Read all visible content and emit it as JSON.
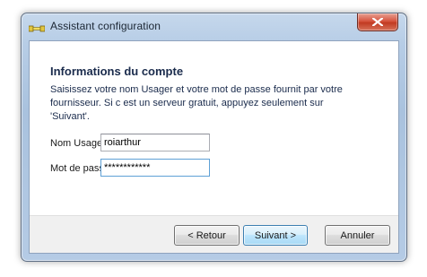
{
  "window": {
    "title": "Assistant configuration",
    "icon": "cable-plug-icon",
    "close_symbol": "close-icon"
  },
  "page": {
    "heading": "Informations du compte",
    "description": "Saisissez votre nom Usager et votre mot de passe fournit par votre fournisseur. Si c est un serveur gratuit, appuyez seulement sur 'Suivant'."
  },
  "form": {
    "username_label": "Nom Usager",
    "username_value": "roiarthur",
    "password_label": "Mot de passe",
    "password_value": "************"
  },
  "buttons": {
    "back": "< Retour",
    "next": "Suivant >",
    "cancel": "Annuler"
  },
  "colors": {
    "heading": "#1a2b4c",
    "close_button": "#c13a22",
    "focused_input_border": "#5ea0d6"
  }
}
